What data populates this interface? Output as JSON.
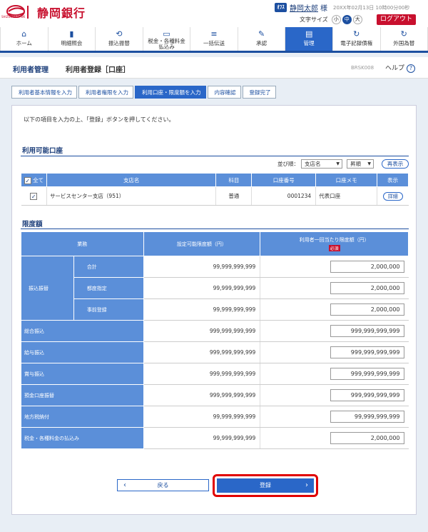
{
  "header": {
    "logo_text": "静岡銀行",
    "logo_sub": "SHIZUOKA BANK",
    "user_badge": "ｵﾌｽ",
    "user_name": "静岡太郎",
    "user_suffix": "様",
    "login_time": "20XX年02月13日 10時00分00秒",
    "font_size_label": "文字サイズ",
    "font_sizes": [
      "小",
      "中",
      "大"
    ],
    "logout": "ログアウト"
  },
  "nav": [
    {
      "label": "ホーム",
      "icon": "house-icon",
      "glyph": "⌂"
    },
    {
      "label": "明細照会",
      "icon": "document-icon",
      "glyph": "▮"
    },
    {
      "label": "振込振替",
      "icon": "transfer-icon",
      "glyph": "⟲"
    },
    {
      "label": "税金・各種料金\n払込み",
      "icon": "payment-icon",
      "glyph": "▭"
    },
    {
      "label": "一括伝送",
      "icon": "stack-icon",
      "glyph": "≡"
    },
    {
      "label": "承認",
      "icon": "approval-icon",
      "glyph": "✎"
    },
    {
      "label": "管理",
      "icon": "admin-icon",
      "glyph": "▤"
    },
    {
      "label": "電子記録債権",
      "icon": "cycle-icon",
      "glyph": "↻"
    },
    {
      "label": "外国為替",
      "icon": "exchange-icon",
      "glyph": "↻"
    }
  ],
  "titlebar": {
    "section": "利用者管理",
    "title": "利用者登録［口座］",
    "code": "BRSK008",
    "help": "ヘルプ",
    "help_icon": "?"
  },
  "steps": [
    "利用者基本情報を入力",
    "利用者権限を入力",
    "利用口座・限度額を入力",
    "内容確認",
    "登録完了"
  ],
  "intro": "以下の項目を入力の上、「登録」ボタンを押してください。",
  "accounts": {
    "title": "利用可能口座",
    "sort_label": "並び順：",
    "sort_field": "支店名",
    "sort_order": "昇順",
    "refresh": "再表示",
    "headers": {
      "all": "全て",
      "branch": "支店名",
      "subject": "科目",
      "number": "口座番号",
      "memo": "口座メモ",
      "display": "表示"
    },
    "rows": [
      {
        "branch": "サービスセンター支店（951）",
        "subject": "普通",
        "number": "0001234",
        "memo": "代表口座",
        "detail": "詳細"
      }
    ]
  },
  "limits": {
    "title": "限度額",
    "headers": {
      "business": "業務",
      "available": "設定可能限度額（円）",
      "per_time": "利用者一回当たり限度額（円）",
      "required": "必須"
    },
    "transfer_group": "振込振替",
    "transfer_rows": [
      {
        "label": "合計",
        "available": "99,999,999,999",
        "value": "2,000,000"
      },
      {
        "label": "都度指定",
        "available": "99,999,999,999",
        "value": "2,000,000"
      },
      {
        "label": "事前登録",
        "available": "99,999,999,999",
        "value": "2,000,000"
      }
    ],
    "rows": [
      {
        "label": "総合振込",
        "available": "999,999,999,999",
        "value": "999,999,999,999"
      },
      {
        "label": "給与振込",
        "available": "999,999,999,999",
        "value": "999,999,999,999"
      },
      {
        "label": "賞与振込",
        "available": "999,999,999,999",
        "value": "999,999,999,999"
      },
      {
        "label": "預金口座振替",
        "available": "999,999,999,999",
        "value": "999,999,999,999"
      },
      {
        "label": "地方税納付",
        "available": "99,999,999,999",
        "value": "99,999,999,999"
      },
      {
        "label": "税金・各種料金の払込み",
        "available": "99,999,999,999",
        "value": "2,000,000"
      }
    ]
  },
  "buttons": {
    "back": "戻る",
    "register": "登録"
  },
  "colors": {
    "brand_red": "#c8102e",
    "nav_blue": "#1c4fa0",
    "header_blue": "#5b8fd9",
    "highlight": "#e00000"
  }
}
